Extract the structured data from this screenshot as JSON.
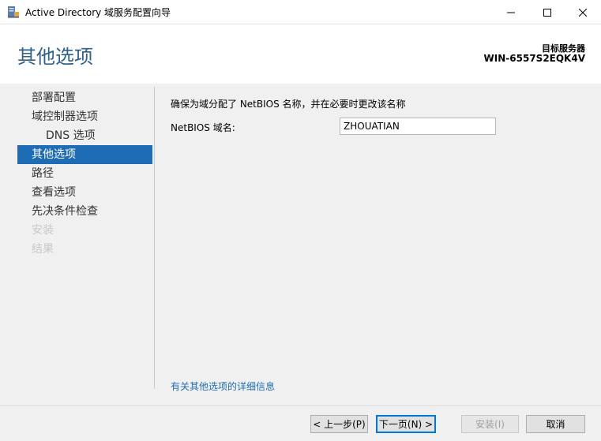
{
  "window": {
    "title": "Active Directory 域服务配置向导",
    "icons": {
      "app": "server-wizard-icon",
      "minimize": "minimize-icon",
      "maximize": "maximize-icon",
      "close": "close-icon"
    }
  },
  "header": {
    "page_title": "其他选项",
    "target_label": "目标服务器",
    "target_server": "WIN-6557S2EQK4V"
  },
  "nav": {
    "items": [
      {
        "label": "部署配置",
        "state": "normal"
      },
      {
        "label": "域控制器选项",
        "state": "normal"
      },
      {
        "label": "DNS 选项",
        "state": "sub"
      },
      {
        "label": "其他选项",
        "state": "active"
      },
      {
        "label": "路径",
        "state": "normal"
      },
      {
        "label": "查看选项",
        "state": "normal"
      },
      {
        "label": "先决条件检查",
        "state": "normal"
      },
      {
        "label": "安装",
        "state": "disabled"
      },
      {
        "label": "结果",
        "state": "disabled"
      }
    ]
  },
  "main": {
    "description": "确保为域分配了 NetBIOS 名称，并在必要时更改该名称",
    "netbios_label": "NetBIOS 域名:",
    "netbios_value": "ZHOUATIAN",
    "more_info_link": "有关其他选项的详细信息"
  },
  "footer": {
    "prev_label": "< 上一步(P)",
    "next_label": "下一页(N) >",
    "install_label": "安装(I)",
    "cancel_label": "取消"
  },
  "colors": {
    "accent": "#1e6cb5",
    "title_blue": "#2f5f8e",
    "panel_bg": "#f0f0f0"
  }
}
